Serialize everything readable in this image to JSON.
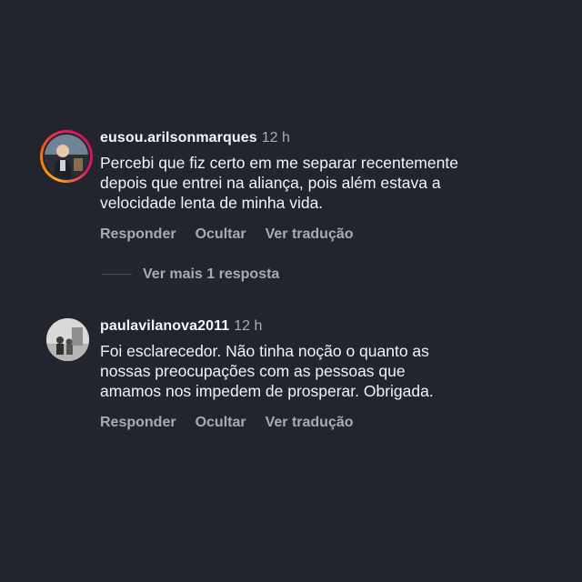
{
  "comments": [
    {
      "username": "eusou.arilsonmarques",
      "time": "12 h",
      "lines": [
        "Percebi que fiz certo em me separar recentemente",
        "depois que entrei na aliança, pois além estava a",
        "velocidade lenta de minha vida."
      ],
      "actions": {
        "reply": "Responder",
        "hide": "Ocultar",
        "translate": "Ver tradução"
      }
    },
    {
      "username": "paulavilanova2011",
      "time": "12 h",
      "lines": [
        "Foi esclarecedor. Não tinha noção o quanto as",
        "nossas preocupações com as pessoas que",
        "amamos nos impedem de prosperar. Obrigada."
      ],
      "actions": {
        "reply": "Responder",
        "hide": "Ocultar",
        "translate": "Ver tradução"
      }
    }
  ],
  "more_replies": "Ver mais 1 resposta",
  "colors": {
    "background": "#22252d",
    "text": "#f3f3f5",
    "muted": "#a8abb3",
    "story_ring": "#e91e63"
  }
}
